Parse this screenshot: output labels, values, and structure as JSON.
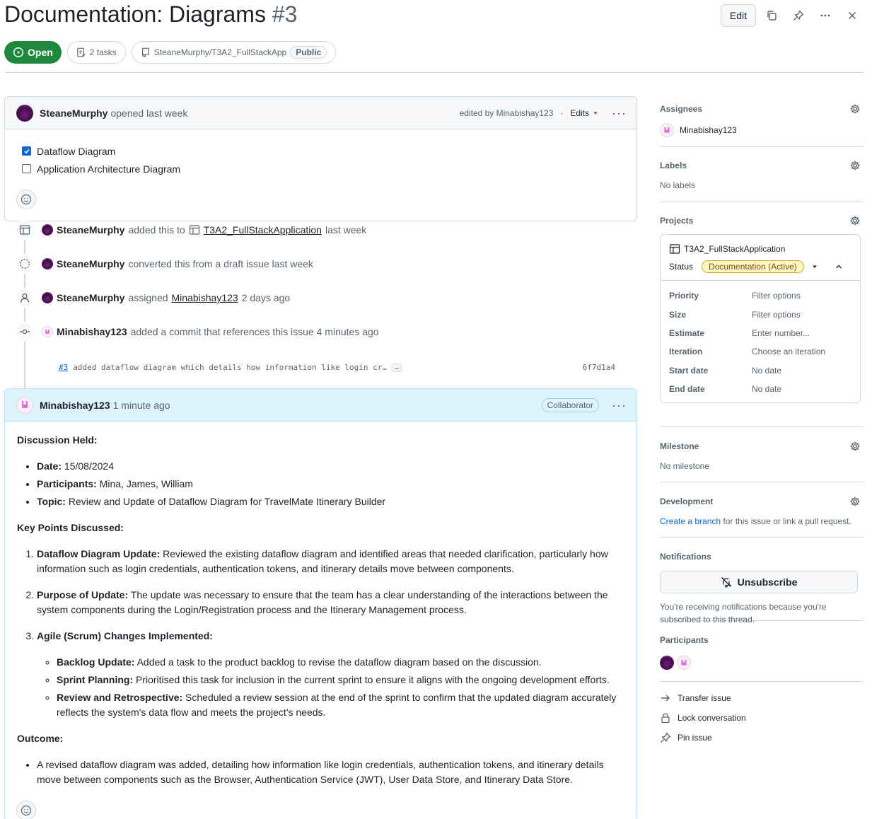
{
  "issue": {
    "title": "Documentation: Diagrams",
    "number": "#3",
    "state": "Open",
    "tasks_label": "2 tasks",
    "repo": "SteaneMurphy/T3A2_FullStackApp",
    "repo_visibility": "Public"
  },
  "header_actions": {
    "edit": "Edit"
  },
  "first_comment": {
    "author": "SteaneMurphy",
    "action": "opened last week",
    "edited_by": "edited by Minabishay123",
    "separator": "·",
    "edits_label": "Edits",
    "tasks": [
      {
        "label": "Dataflow Diagram",
        "checked": true
      },
      {
        "label": "Application Architecture Diagram",
        "checked": false
      }
    ]
  },
  "timeline": {
    "e1": {
      "actor": "SteaneMurphy",
      "pre": "added this to",
      "project": "T3A2_FullStackApplication",
      "post": "last week"
    },
    "e2": {
      "actor": "SteaneMurphy",
      "text": "converted this from a draft issue last week"
    },
    "e3": {
      "actor": "SteaneMurphy",
      "pre": "assigned",
      "target": "Minabishay123",
      "post": "2 days ago"
    },
    "e4": {
      "actor": "Minabishay123",
      "text": "added a commit that references this issue 4 minutes ago"
    },
    "commit": {
      "ref": "#3",
      "message": "added dataflow diagram which details how information like login cr…",
      "ellipsis": "…",
      "sha": "6f7d1a4"
    }
  },
  "second_comment": {
    "author": "Minabishay123",
    "time": "1 minute ago",
    "role": "Collaborator",
    "discussion_heading": "Discussion Held:",
    "meta": [
      {
        "k": "Date:",
        "v": " 15/08/2024"
      },
      {
        "k": "Participants:",
        "v": " Mina, James, William"
      },
      {
        "k": "Topic:",
        "v": " Review and Update of Dataflow Diagram for TravelMate Itinerary Builder"
      }
    ],
    "key_points_heading": "Key Points Discussed:",
    "points": [
      {
        "k": "Dataflow Diagram Update:",
        "v": " Reviewed the existing dataflow diagram and identified areas that needed clarification, particularly how information such as login credentials, authentication tokens, and itinerary details move between components."
      },
      {
        "k": "Purpose of Update:",
        "v": " The update was necessary to ensure that the team has a clear understanding of the interactions between the system components during the Login/Registration process and the Itinerary Management process."
      },
      {
        "k": "Agile (Scrum) Changes Implemented:",
        "v": ""
      }
    ],
    "agile": [
      {
        "k": "Backlog Update:",
        "v": " Added a task to the product backlog to revise the dataflow diagram based on the discussion."
      },
      {
        "k": "Sprint Planning:",
        "v": " Prioritised this task for inclusion in the current sprint to ensure it aligns with the ongoing development efforts."
      },
      {
        "k": "Review and Retrospective:",
        "v": " Scheduled a review session at the end of the sprint to confirm that the updated diagram accurately reflects the system's data flow and meets the project's needs."
      }
    ],
    "outcome_heading": "Outcome:",
    "outcome": "A revised dataflow diagram was added, detailing how information like login credentials, authentication tokens, and itinerary details move between components such as the Browser, Authentication Service (JWT), User Data Store, and Itinerary Data Store."
  },
  "sidebar": {
    "assignees": {
      "title": "Assignees",
      "user": "Minabishay123"
    },
    "labels": {
      "title": "Labels",
      "value": "No labels"
    },
    "projects": {
      "title": "Projects",
      "name": "T3A2_FullStackApplication",
      "status_label": "Status",
      "status_value": "Documentation (Active)",
      "fields": [
        {
          "k": "Priority",
          "v": "Filter options"
        },
        {
          "k": "Size",
          "v": "Filter options"
        },
        {
          "k": "Estimate",
          "v": "Enter number..."
        },
        {
          "k": "Iteration",
          "v": "Choose an iteration"
        },
        {
          "k": "Start date",
          "v": "No date"
        },
        {
          "k": "End date",
          "v": "No date"
        }
      ]
    },
    "milestone": {
      "title": "Milestone",
      "value": "No milestone"
    },
    "development": {
      "title": "Development",
      "link": "Create a branch",
      "rest": " for this issue or link a pull request."
    },
    "notifications": {
      "title": "Notifications",
      "button": "Unsubscribe",
      "note": "You're receiving notifications because you're subscribed to this thread."
    },
    "participants": {
      "title": "Participants"
    },
    "actions": {
      "transfer": "Transfer issue",
      "lock": "Lock conversation",
      "pin": "Pin issue"
    }
  },
  "colors": {
    "open_green": "#1f883d",
    "link_blue": "#0969da",
    "status_yellow": "#fff8c5"
  }
}
